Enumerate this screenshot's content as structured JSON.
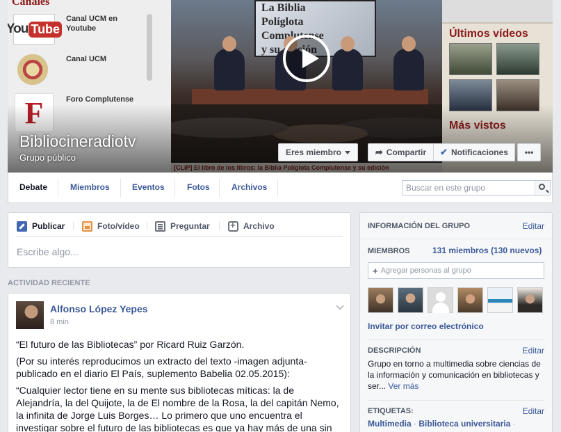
{
  "cover": {
    "channels_heading": "Canales",
    "channels": [
      {
        "label": "Canal UCM en Youtube",
        "logo_text": "You",
        "logo_badge": "Tube"
      },
      {
        "label": "Canal UCM"
      },
      {
        "label": "Foro Complutense",
        "logo_text": "F"
      }
    ],
    "video_screen_lines": [
      "La Biblia",
      "Políglota",
      "Complutense",
      "y su edición"
    ],
    "video_caption": "[CLIP] El libro de los libros: la Biblia Políglota Complutense y su edición",
    "right_heading_1": "Últimos vídeos",
    "right_heading_2": "Más vistos",
    "group_name": "Bibliocineradiotv",
    "group_type": "Grupo público",
    "buttons": {
      "member": "Eres miembro",
      "share": "Compartir",
      "notifications": "Notificaciones",
      "more": "•••"
    }
  },
  "tabs": [
    "Debate",
    "Miembros",
    "Eventos",
    "Fotos",
    "Archivos"
  ],
  "search": {
    "placeholder": "Buscar en este grupo"
  },
  "composer": {
    "tabs": [
      "Publicar",
      "Foto/vídeo",
      "Preguntar",
      "Archivo"
    ],
    "placeholder": "Escribe algo..."
  },
  "recent_activity": {
    "heading": "ACTIVIDAD RECIENTE",
    "post": {
      "author": "Alfonso López Yepes",
      "time": "8 min",
      "paragraphs": [
        "“El futuro de las Bibliotecas” por Ricard Ruiz Garzón.",
        "(Por su interés reproducimos un extracto del texto -imagen adjunta- publicado en el diario El País, suplemento Babelia 02.05.2015):",
        "“Cualquier lector tiene en su mente sus bibliotecas míticas: la de Alejandría, la del Quijote, la de El nombre de la Rosa, la del capitán Nemo, la infinita de Jorge Luis Borges… Lo primero que uno encuentra el investigar sobre el futuro de las bibliotecas es que ya hay más de una sin"
      ]
    }
  },
  "group_info": {
    "heading": "INFORMACIÓN DEL GRUPO",
    "edit_label": "Editar",
    "members_label": "MIEMBROS",
    "members_count": "131 miembros",
    "members_new": "(130 nuevos)",
    "add_people_placeholder": "Agregar personas al grupo",
    "invite_label": "Invitar por correo electrónico",
    "description_label": "DESCRIPCIÓN",
    "description_text": "Grupo en torno a multimedia sobre ciencias de la información y comunicación en bibliotecas y ser...",
    "see_more": "Ver más",
    "tags_label": "ETIQUETAS:",
    "tags": [
      "Multimedia",
      "Biblioteca universitaria"
    ]
  }
}
